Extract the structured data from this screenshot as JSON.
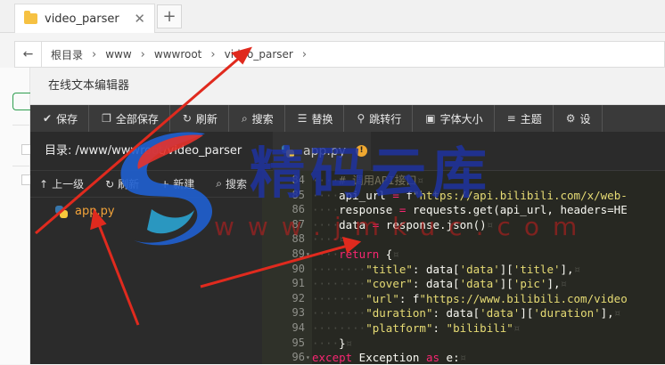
{
  "browser": {
    "tab_title": "video_parser",
    "tab_close": "✕",
    "new_tab": "+"
  },
  "address": {
    "back": "←",
    "crumbs": [
      "根目录",
      "www",
      "wwwroot",
      "video_parser"
    ]
  },
  "editor": {
    "title": "在线文本编辑器",
    "toolbar": [
      {
        "icon": "check-icon",
        "glyph": "✔",
        "label": "保存"
      },
      {
        "icon": "copy-icon",
        "glyph": "❐",
        "label": "全部保存"
      },
      {
        "icon": "refresh-icon",
        "glyph": "↻",
        "label": "刷新"
      },
      {
        "icon": "search-icon",
        "glyph": "⌕",
        "label": "搜索"
      },
      {
        "icon": "replace-icon",
        "glyph": "☰",
        "label": "替换"
      },
      {
        "icon": "jump-icon",
        "glyph": "⚲",
        "label": "跳转行"
      },
      {
        "icon": "font-icon",
        "glyph": "▣",
        "label": "字体大小"
      },
      {
        "icon": "theme-icon",
        "glyph": "≡",
        "label": "主题"
      },
      {
        "icon": "settings-icon",
        "glyph": "⚙",
        "label": "设"
      }
    ],
    "directory_label": "目录: /www/wwwroot/video_parser",
    "side_ops": [
      {
        "icon": "up-arrow-icon",
        "glyph": "↑",
        "label": "上一级"
      },
      {
        "icon": "refresh-icon",
        "glyph": "↻",
        "label": "刷新"
      },
      {
        "icon": "plus-icon",
        "glyph": "+",
        "label": "新建"
      },
      {
        "icon": "search-icon",
        "glyph": "⌕",
        "label": "搜索"
      }
    ],
    "file_name": "app.py",
    "open_tab": "app.py",
    "tab_badge": "!"
  },
  "watermark": {
    "text": "精码云库",
    "url": "www.jmkuc.com"
  },
  "code_lines": [
    {
      "n": "84",
      "fold": "",
      "html": "<span class='ws'>····</span><span class='cm'># 调用API接口</span><span class='mark'>¤</span>"
    },
    {
      "n": "85",
      "fold": "",
      "html": "<span class='ws'>····</span>api_url <span class='op2'>=</span> f<span class='st'>\"https://api.bilibili.com/x/web-</span>"
    },
    {
      "n": "86",
      "fold": "",
      "html": "<span class='ws'>····</span>response <span class='op2'>=</span> requests.get(api_url, headers=HE"
    },
    {
      "n": "87",
      "fold": "",
      "html": "<span class='ws'>····</span>data <span class='op2'>=</span> response.json()<span class='mark'>¤</span>"
    },
    {
      "n": "88",
      "fold": "",
      "html": "<span class='ws'>····</span><span class='mark'>¤</span>"
    },
    {
      "n": "89",
      "fold": "▾",
      "html": "<span class='ws'>····</span><span class='kw'>return</span> {<span class='mark'>¤</span>"
    },
    {
      "n": "90",
      "fold": "",
      "html": "<span class='ws'>········</span><span class='st'>\"title\"</span>: data[<span class='st'>'data'</span>][<span class='st'>'title'</span>],<span class='mark'>¤</span>"
    },
    {
      "n": "91",
      "fold": "",
      "html": "<span class='ws'>········</span><span class='st'>\"cover\"</span>: data[<span class='st'>'data'</span>][<span class='st'>'pic'</span>],<span class='mark'>¤</span>"
    },
    {
      "n": "92",
      "fold": "",
      "html": "<span class='ws'>········</span><span class='st'>\"url\"</span>: f<span class='st'>\"https://www.bilibili.com/video</span>"
    },
    {
      "n": "93",
      "fold": "",
      "html": "<span class='ws'>········</span><span class='st'>\"duration\"</span>: data[<span class='st'>'data'</span>][<span class='st'>'duration'</span>],<span class='mark'>¤</span>"
    },
    {
      "n": "94",
      "fold": "",
      "html": "<span class='ws'>········</span><span class='st'>\"platform\"</span>: <span class='st'>\"bilibili\"</span><span class='mark'>¤</span>"
    },
    {
      "n": "95",
      "fold": "",
      "html": "<span class='ws'>····</span>}<span class='mark'>¤</span>"
    },
    {
      "n": "96",
      "fold": "▾",
      "html": "<span class='kw'>except</span> Exception <span class='kw'>as</span> e:<span class='mark'>¤</span>"
    }
  ]
}
